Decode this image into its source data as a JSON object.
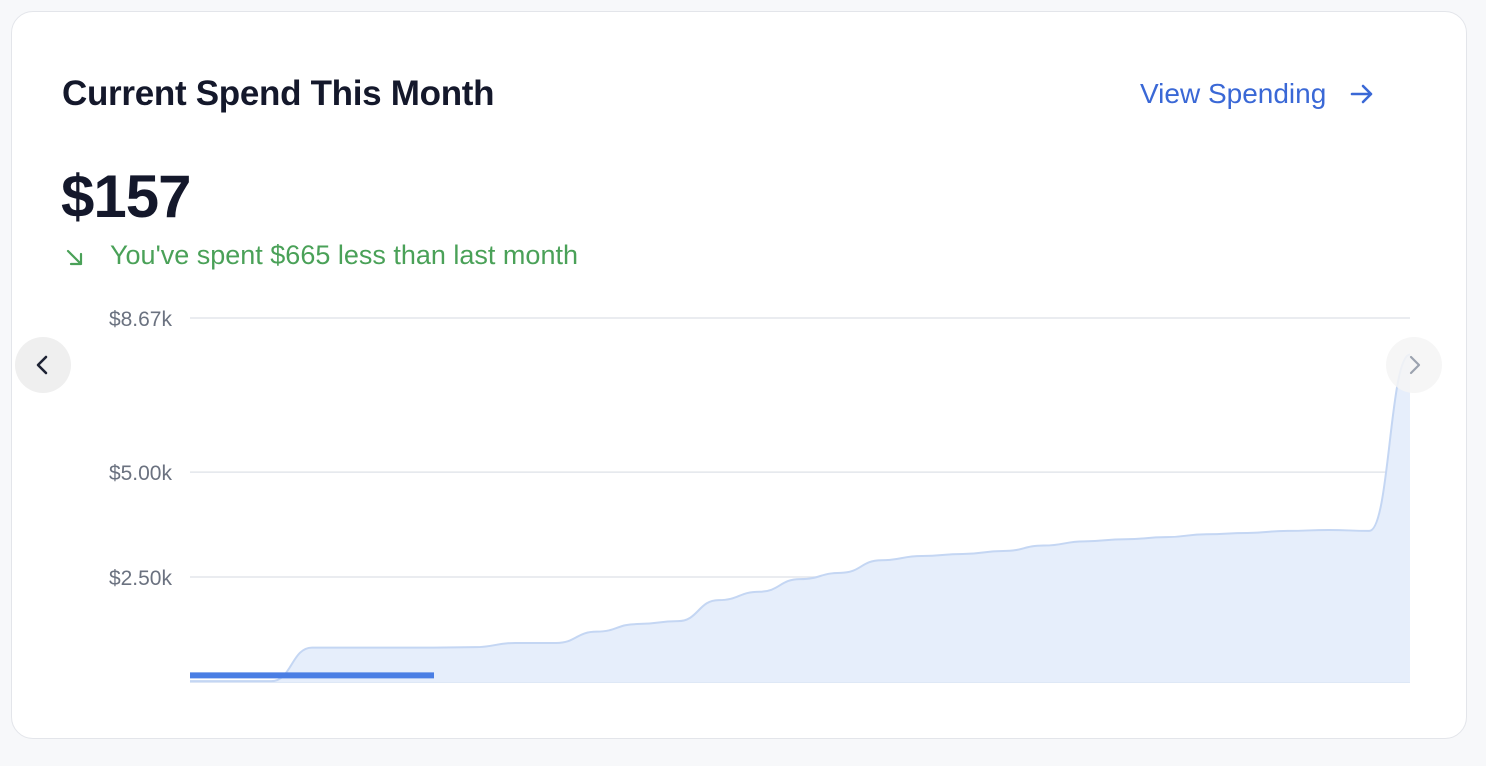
{
  "card": {
    "title": "Current Spend This Month",
    "view_link_label": "View Spending",
    "view_link_icon": "arrow-right-icon",
    "amount": "$157",
    "comparison_text": "You've spent $665 less than last month",
    "comparison_icon": "arrow-down-right-icon"
  },
  "colors": {
    "accent": "#3a68d6",
    "positive": "#4aa158",
    "area_fill": "#e6eefb",
    "area_line": "#c4d6f3",
    "current_bar": "#4a7ee4",
    "gridline": "#e3e6eb"
  },
  "navigation": {
    "prev_icon": "chevron-left-icon",
    "next_icon": "chevron-right-icon"
  },
  "chart_data": {
    "type": "area",
    "y_ticks": [
      "$8.67k",
      "$5.00k",
      "$2.50k"
    ],
    "y_tick_values": [
      8670,
      5000,
      2500
    ],
    "ylim": [
      0,
      8670
    ],
    "grid": true,
    "x": [
      1,
      2,
      3,
      4,
      5,
      6,
      7,
      8,
      9,
      10,
      11,
      12,
      13,
      14,
      15,
      16,
      17,
      18,
      19,
      20,
      21,
      22,
      23,
      24,
      25,
      26,
      27,
      28,
      29,
      30,
      31
    ],
    "series": [
      {
        "values": [
          20,
          20,
          20,
          820,
          820,
          820,
          820,
          830,
          930,
          930,
          1200,
          1380,
          1450,
          1950,
          2150,
          2450,
          2600,
          2900,
          3000,
          3050,
          3120,
          3250,
          3350,
          3400,
          3450,
          3520,
          3550,
          3600,
          3620,
          3600,
          7800
        ]
      }
    ],
    "current_period": {
      "from_x": 1,
      "to_x": 7,
      "value": 157
    }
  }
}
